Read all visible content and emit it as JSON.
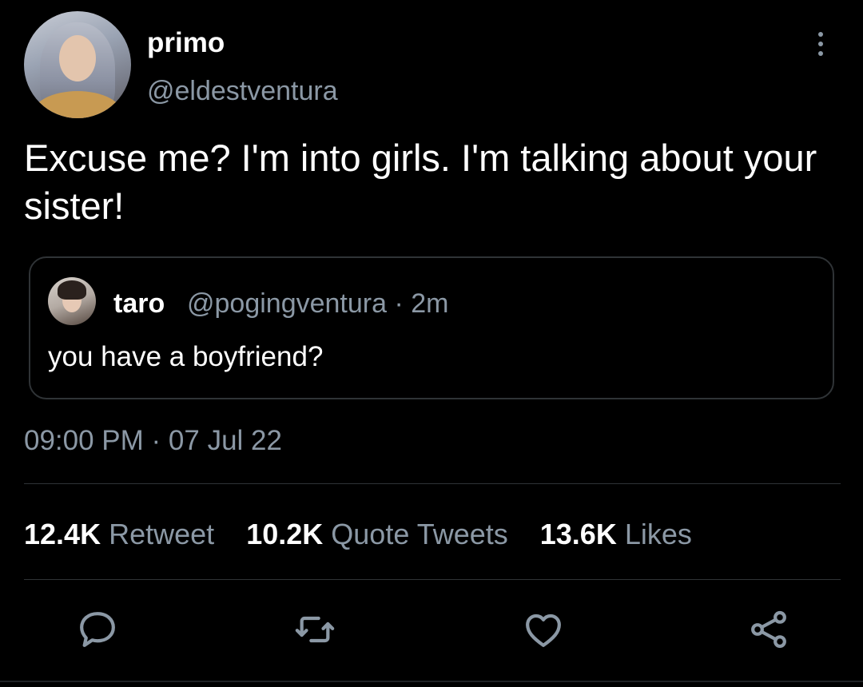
{
  "tweet": {
    "author": {
      "name": "primo",
      "handle": "@eldestventura"
    },
    "text": "Excuse me? I'm into girls. I'm talking about your sister!",
    "quoted": {
      "name": "taro",
      "handle_time": "@pogingventura · 2m",
      "text": "you have a boyfriend?"
    },
    "timestamp": "09:00 PM · 07 Jul 22",
    "stats": [
      {
        "count": "12.4K",
        "label": "Retweet"
      },
      {
        "count": "10.2K",
        "label": "Quote Tweets"
      },
      {
        "count": "13.6K",
        "label": "Likes"
      }
    ]
  },
  "actions": [
    {
      "icon": "reply-icon"
    },
    {
      "icon": "retweet-icon"
    },
    {
      "icon": "like-icon"
    },
    {
      "icon": "share-icon"
    }
  ],
  "colors": {
    "background": "#000000",
    "text": "#ffffff",
    "secondary": "#8b98a5",
    "border": "#2f3336"
  }
}
